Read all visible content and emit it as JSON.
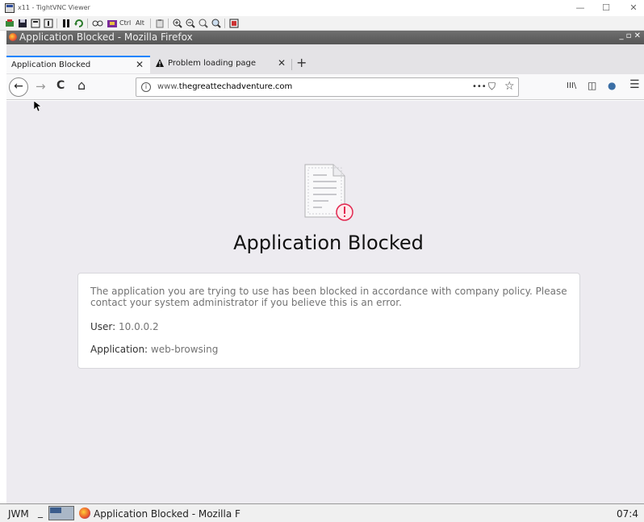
{
  "vnc": {
    "title": "x11 - TightVNC Viewer",
    "toolbar": {
      "ctrl_label": "Ctrl",
      "alt_label": "Alt"
    },
    "window_controls": {
      "minimize": "—",
      "maximize": "☐",
      "close": "✕"
    }
  },
  "firefox": {
    "window_title": "Application Blocked - Mozilla Firefox",
    "window_controls": "_ ▫ ✕",
    "tabs": [
      {
        "label": "Application Blocked",
        "active": true
      },
      {
        "label": "Problem loading page",
        "active": false
      }
    ],
    "tab_close": "✕",
    "new_tab": "+",
    "nav": {
      "back": "←",
      "forward": "→",
      "reload": "C",
      "home": "⌂"
    },
    "url_prefix": "www.",
    "url_domain": "thegreattechadventure.com",
    "url_actions": {
      "more": "•••",
      "pocket": "⛉",
      "bookmark": "☆"
    },
    "toolbar_right": {
      "library": "III\\",
      "sidebar": "◫",
      "account": "●",
      "menu": "☰"
    }
  },
  "page": {
    "heading": "Application Blocked",
    "message": "The application you are trying to use has been blocked in accordance with company policy. Please contact your system administrator if you believe this is an error.",
    "user_key": "User:",
    "user_value": "10.0.0.2",
    "application_key": "Application:",
    "application_value": "web-browsing"
  },
  "taskbar": {
    "menu_label": "JWM",
    "minimize": "_",
    "task_label": "Application Blocked - Mozilla F",
    "clock": "07:4"
  },
  "colors": {
    "accent": "#0a84ff",
    "content_bg": "#edebf0",
    "alert_red": "#e22850"
  }
}
